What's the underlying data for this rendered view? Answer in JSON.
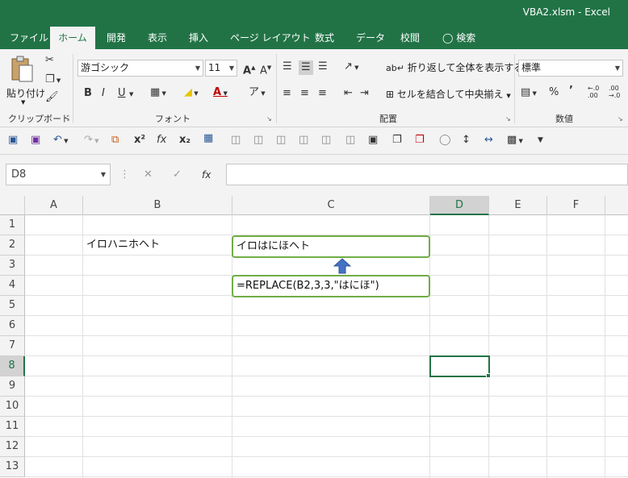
{
  "window": {
    "title": "VBA2.xlsm  -  Excel"
  },
  "tabs": [
    "ファイル",
    "ホーム",
    "開発",
    "表示",
    "挿入",
    "ページ レイアウト",
    "数式",
    "データ",
    "校閲"
  ],
  "active_tab": "ホーム",
  "search": {
    "label": "検索"
  },
  "ribbon": {
    "clipboard": {
      "paste_label": "貼り付け",
      "group_label": "クリップボード"
    },
    "font": {
      "font_name": "游ゴシック",
      "font_size": "11",
      "group_label": "フォント",
      "bold": "B",
      "italic": "I",
      "underline": "U"
    },
    "alignment": {
      "wrap_label": "折り返して全体を表示する",
      "merge_label": "セルを結合して中央揃え",
      "group_label": "配置"
    },
    "number": {
      "format": "標準",
      "percent": "%",
      "comma": "’",
      "group_label": "数値",
      "inc_decimal": "←.0 .00",
      "dec_decimal": ".00 →.0"
    }
  },
  "formula_bar": {
    "name_box": "D8",
    "fx_label": "fx",
    "content": ""
  },
  "columns": [
    "A",
    "B",
    "C",
    "D",
    "E",
    "F"
  ],
  "rows": [
    "1",
    "2",
    "3",
    "4",
    "5",
    "6",
    "7",
    "8",
    "9",
    "10",
    "11",
    "12",
    "13"
  ],
  "selected": {
    "column": "D",
    "row": "8",
    "cell": "D8"
  },
  "cells": {
    "B2": "イロハニホヘト",
    "C2": "イロはにほヘト",
    "C4": "=REPLACE(B2,3,3,\"はにほ\")"
  },
  "colors": {
    "excel_green": "#217346",
    "callout_border": "#70ad47",
    "arrow": "#4472c4"
  }
}
